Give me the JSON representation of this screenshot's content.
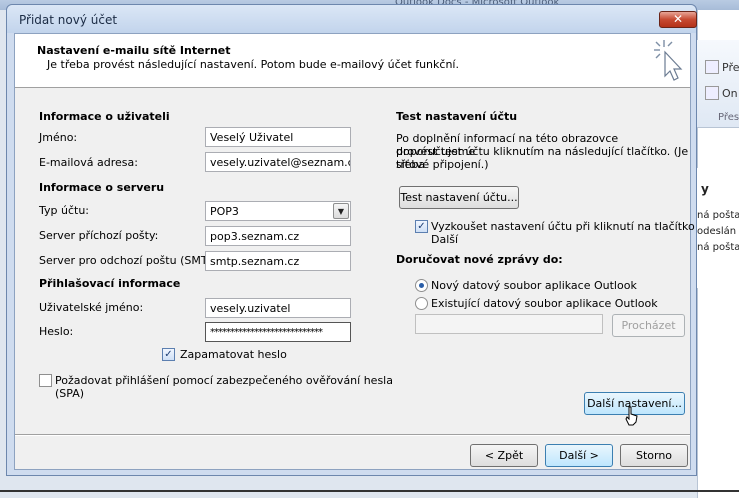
{
  "background": {
    "title": "Outlook Docs - Microsoft Outlook",
    "ribbon": [
      "Pře",
      "On",
      "Přes"
    ],
    "list": [
      "y",
      "ná pošta",
      "odeslán",
      "ná pošta"
    ]
  },
  "dialog": {
    "title": "Přidat nový účet",
    "close": "✕",
    "header_title": "Nastavení e-mailu sítě Internet",
    "header_sub": "Je třeba provést následující nastavení. Potom bude e-mailový účet funkční."
  },
  "user_info": {
    "heading": "Informace o uživateli",
    "name_label": "Jméno:",
    "name_value": "Veselý Uživatel",
    "email_label": "E-mailová adresa:",
    "email_value": "vesely.uzivatel@seznam.cz"
  },
  "server_info": {
    "heading": "Informace o serveru",
    "type_label": "Typ účtu:",
    "type_value": "POP3",
    "incoming_label": "Server příchozí pošty:",
    "incoming_value": "pop3.seznam.cz",
    "outgoing_label": "Server pro odchozí poštu (SMTP):",
    "outgoing_value": "smtp.seznam.cz"
  },
  "login_info": {
    "heading": "Přihlašovací informace",
    "username_label": "Uživatelské jméno:",
    "username_value": "vesely.uzivatel",
    "password_label": "Heslo:",
    "password_value": "****************************",
    "remember_label": "Zapamatovat heslo",
    "spa_label_1": "Požadovat přihlášení pomocí zabezpečeného ověřování hesla",
    "spa_label_2": "(SPA)"
  },
  "test": {
    "heading": "Test nastavení účtu",
    "para_1": "Po doplnění informací na této obrazovce doporučujeme",
    "para_2": "provést test účtu kliknutím na následující tlačítko. (Je třeba",
    "para_3": "síťové připojení.)",
    "test_button": "Test nastavení účtu...",
    "auto_test_1": "Vyzkoušet nastavení účtu při kliknutí na tlačítko",
    "auto_test_2": "Další"
  },
  "delivery": {
    "heading": "Doručovat nové zprávy do:",
    "new_file": "Nový datový soubor aplikace Outlook",
    "existing_file": "Existující datový soubor aplikace Outlook",
    "browse": "Procházet"
  },
  "buttons": {
    "more_settings": "Další nastavení...",
    "back": "< Zpět",
    "next": "Další >",
    "cancel": "Storno"
  }
}
